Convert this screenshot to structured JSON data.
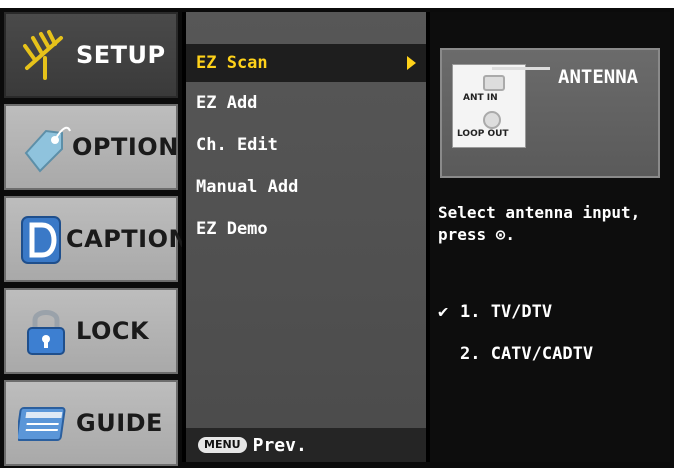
{
  "categories": [
    {
      "label": "SETUP",
      "icon": "antenna-icon",
      "active": true
    },
    {
      "label": "OPTION",
      "icon": "tag-icon",
      "active": false
    },
    {
      "label": "CAPTION",
      "icon": "caption-d-icon",
      "active": false
    },
    {
      "label": "LOCK",
      "icon": "padlock-icon",
      "active": false
    },
    {
      "label": "GUIDE",
      "icon": "guide-card-icon",
      "active": false
    }
  ],
  "submenu": {
    "items": [
      {
        "label": "EZ Scan",
        "selected": true
      },
      {
        "label": "EZ Add",
        "selected": false
      },
      {
        "label": "Ch. Edit",
        "selected": false
      },
      {
        "label": "Manual Add",
        "selected": false
      },
      {
        "label": "EZ Demo",
        "selected": false
      }
    ],
    "menu_button": "MENU",
    "prev_label": "Prev."
  },
  "panel": {
    "ant_in": "ANT IN",
    "loop_out": "LOOP OUT",
    "antenna_label": "ANTENNA",
    "instruction_line1": "Select antenna input,",
    "instruction_line2": "press ⊙.",
    "options": [
      {
        "label": "1. TV/DTV",
        "checked": true
      },
      {
        "label": "2. CATV/CADTV",
        "checked": false
      }
    ]
  },
  "colors": {
    "highlight_text": "#ffd21a",
    "selected_bg": "#1e1e1e",
    "submenu_bg": "#575757",
    "category_bg": "#b5b5b5"
  }
}
